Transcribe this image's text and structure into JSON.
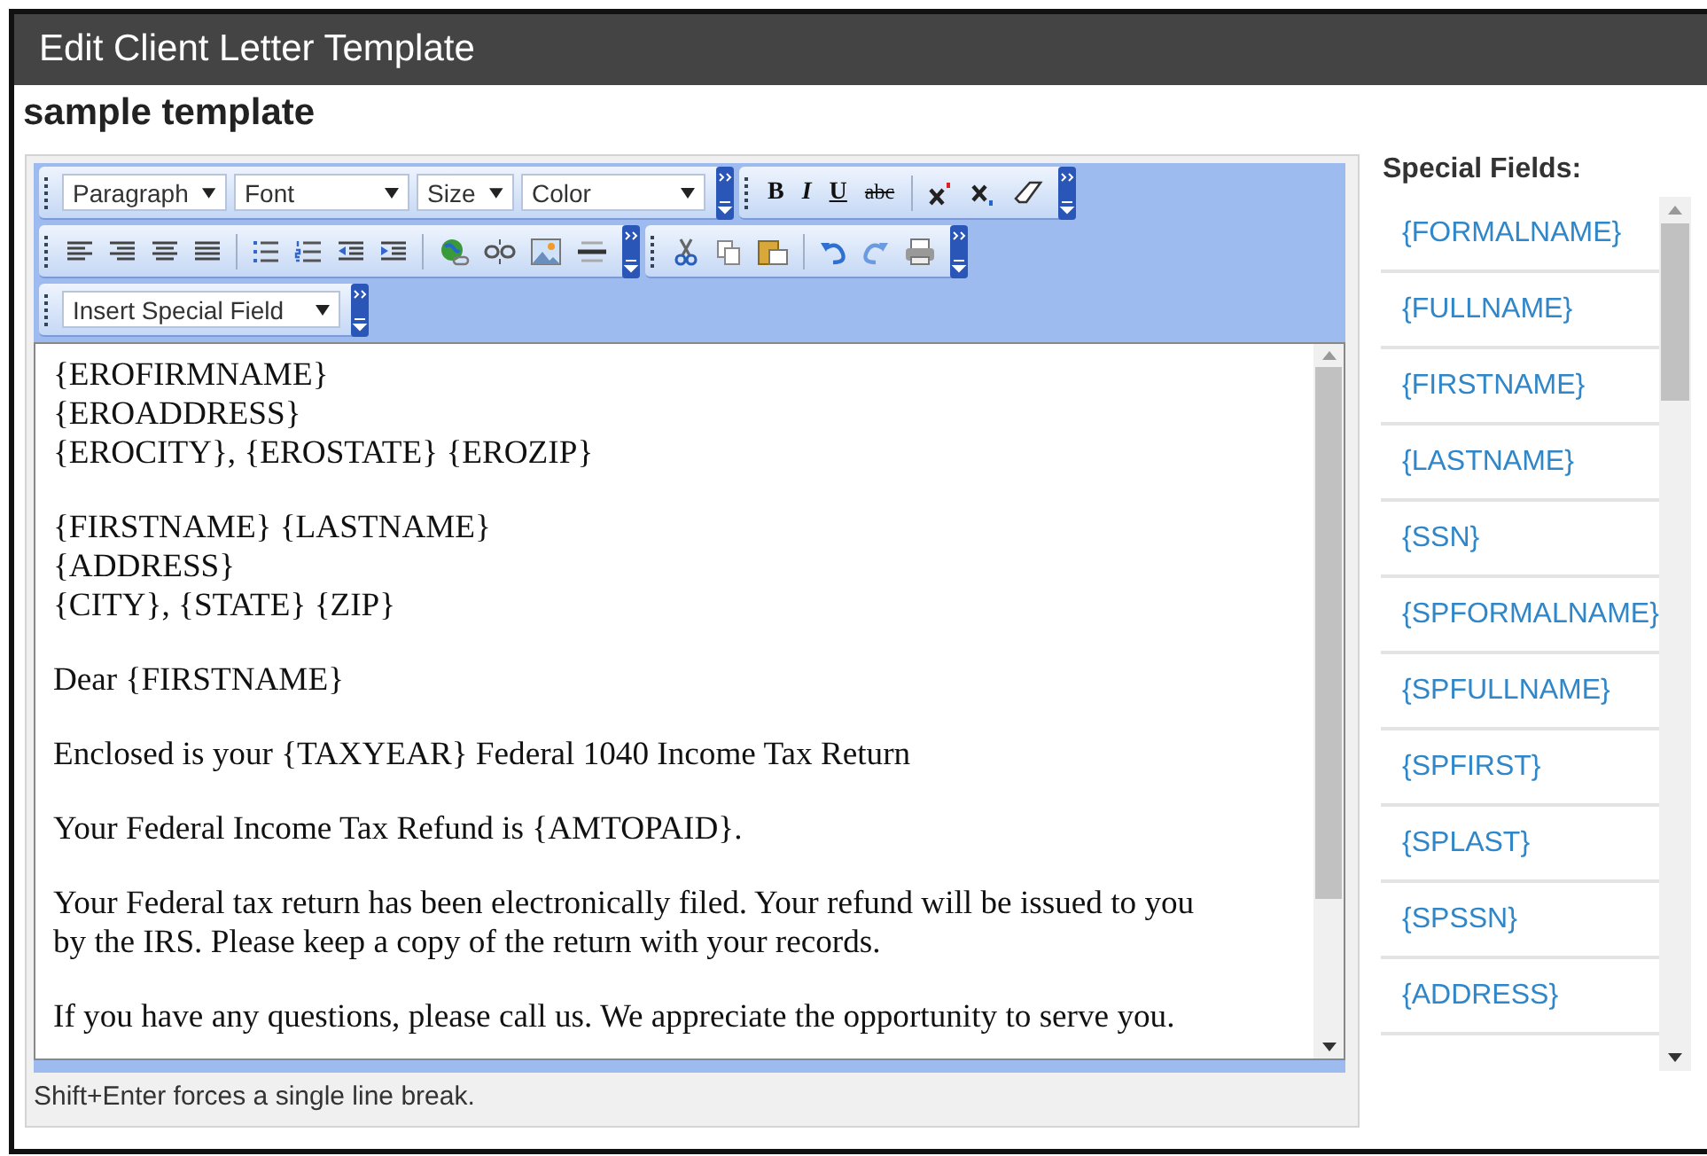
{
  "window": {
    "title": "Edit Client Letter Template"
  },
  "template_name": "sample template",
  "toolbar": {
    "dropdowns": [
      {
        "label": "Paragraph"
      },
      {
        "label": "Font"
      },
      {
        "label": "Size"
      },
      {
        "label": "Color"
      }
    ],
    "format_buttons": [
      {
        "label": "B",
        "kind": "bold"
      },
      {
        "label": "I",
        "kind": "italic"
      },
      {
        "label": "U",
        "kind": "underline"
      },
      {
        "label": "abc",
        "kind": "strike"
      }
    ],
    "special_field_dropdown": {
      "label": "Insert Special Field"
    }
  },
  "letter": {
    "paragraphs": [
      [
        "{EROFIRMNAME}",
        "{EROADDRESS}",
        "{EROCITY}, {EROSTATE} {EROZIP}"
      ],
      [
        "{FIRSTNAME} {LASTNAME}",
        "{ADDRESS}",
        "{CITY}, {STATE} {ZIP}"
      ],
      [
        "Dear {FIRSTNAME}"
      ],
      [
        "Enclosed is your {TAXYEAR} Federal 1040 Income Tax Return"
      ],
      [
        "Your Federal Income Tax Refund is {AMTOPAID}."
      ],
      [
        "Your Federal tax return has been electronically filed. Your refund will be issued to you by the IRS. Please keep a copy of the return with your records."
      ],
      [
        "If you have any questions, please call us. We appreciate the opportunity to serve you."
      ]
    ]
  },
  "status_hint": "Shift+Enter forces a single line break.",
  "special_fields": {
    "title": "Special Fields:",
    "items": [
      "{FORMALNAME}",
      "{FULLNAME}",
      "{FIRSTNAME}",
      "{LASTNAME}",
      "{SSN}",
      "{SPFORMALNAME}",
      "{SPFULLNAME}",
      "{SPFIRST}",
      "{SPLAST}",
      "{SPSSN}",
      "{ADDRESS}"
    ]
  }
}
